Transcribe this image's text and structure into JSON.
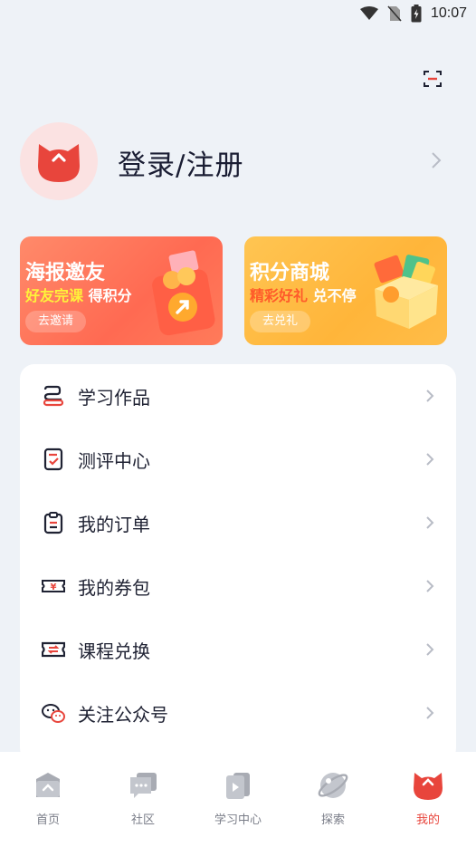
{
  "status_bar": {
    "time": "10:07"
  },
  "profile": {
    "login_label": "登录/注册"
  },
  "banners": [
    {
      "title": "海报邀友",
      "sub_highlight": "好友完课",
      "sub_rest": "得积分",
      "button": "去邀请"
    },
    {
      "title": "积分商城",
      "sub_highlight": "精彩好礼",
      "sub_rest": "兑不停",
      "button": "去兑礼"
    }
  ],
  "menu": [
    {
      "label": "学习作品",
      "icon": "works-icon"
    },
    {
      "label": "测评中心",
      "icon": "evaluation-icon"
    },
    {
      "label": "我的订单",
      "icon": "order-icon"
    },
    {
      "label": "我的券包",
      "icon": "coupon-icon"
    },
    {
      "label": "课程兑换",
      "icon": "exchange-icon"
    },
    {
      "label": "关注公众号",
      "icon": "wechat-icon"
    }
  ],
  "tabs": [
    {
      "label": "首页",
      "icon": "home-icon"
    },
    {
      "label": "社区",
      "icon": "community-icon"
    },
    {
      "label": "学习中心",
      "icon": "study-center-icon"
    },
    {
      "label": "探索",
      "icon": "explore-icon"
    },
    {
      "label": "我的",
      "icon": "mine-icon",
      "active": true
    }
  ],
  "colors": {
    "accent": "#e8453c",
    "banner1": "#ff7b5a",
    "banner2": "#ffbd48",
    "highlight": "#fff23a"
  }
}
